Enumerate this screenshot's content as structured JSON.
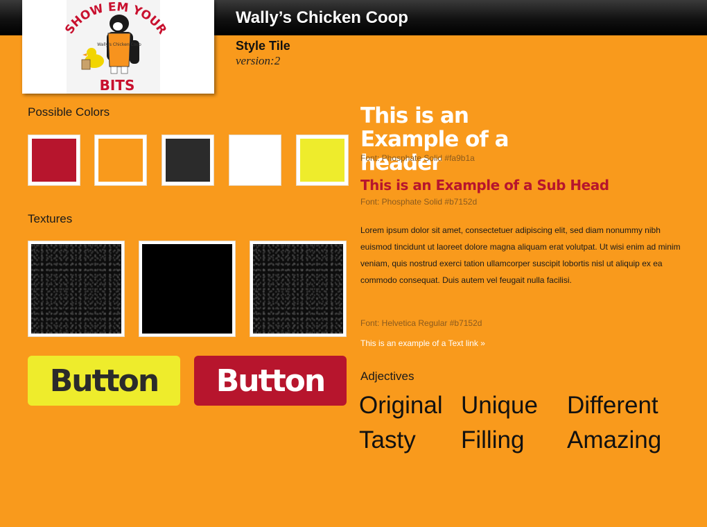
{
  "header": {
    "title": "Wally’s Chicken Coop"
  },
  "tile": {
    "label": "Style Tile",
    "version": "version:2"
  },
  "logo": {
    "top_text": "SHOW EM YOUR",
    "bottom_text": "BITS",
    "apron_text": "Wally's Chicken Coop"
  },
  "colors": {
    "label": "Possible Colors",
    "swatches": [
      "#b7152d",
      "#f99a1c",
      "#2b2b2b",
      "#ffffff",
      "#eeec2c"
    ]
  },
  "textures": {
    "label": "Textures"
  },
  "buttons": {
    "yellow_label": "Button",
    "red_label": "Button"
  },
  "typography": {
    "header_example": "This is an Example of a header",
    "header_font": "Font: Phosphate Solid #fa9b1a",
    "subhead_example": "This is an Example of a Sub Head",
    "subhead_font": "Font: Phosphate Solid #b7152d",
    "body_text": "Lorem ipsum dolor sit amet, consectetuer adipiscing elit, sed diam nonummy nibh euismod tincidunt ut laoreet dolore magna aliquam erat volutpat. Ut wisi enim ad minim veniam, quis nostrud exerci tation ullamcorper suscipit lobortis nisl ut aliquip ex ea commodo consequat. Duis autem vel feugait nulla facilisi.",
    "body_font": "Font: Helvetica Regular #b7152d",
    "link_text": "This is an example of a Text link »"
  },
  "adjectives": {
    "label": "Adjectives",
    "words": [
      "Original",
      "Unique",
      "Different",
      "Tasty",
      "Filling",
      "Amazing"
    ]
  },
  "chart_data": {
    "type": "table",
    "title": "Style Tile",
    "colors": [
      "#b7152d",
      "#f99a1c",
      "#2b2b2b",
      "#ffffff",
      "#eeec2c"
    ],
    "adjectives": [
      "Original",
      "Unique",
      "Different",
      "Tasty",
      "Filling",
      "Amazing"
    ]
  }
}
